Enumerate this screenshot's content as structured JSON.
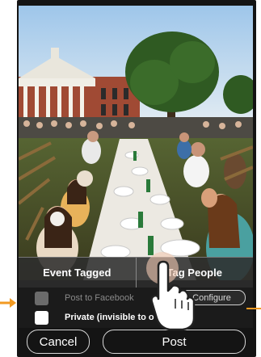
{
  "tabs": [
    {
      "label": "Event Tagged"
    },
    {
      "label": "Tag People"
    }
  ],
  "options": {
    "facebook": {
      "label": "Post to Facebook",
      "checked": false
    },
    "private": {
      "label": "Private (invisible to o",
      "checked": true
    },
    "configure_label": "Configure"
  },
  "buttons": {
    "cancel": "Cancel",
    "post": "Post"
  },
  "colors": {
    "accent_arrow": "#F29A22",
    "panel": "#1B1B1B",
    "phone": "#141414"
  },
  "icons": [
    "hand-pointer-icon",
    "orange-arrow-icon"
  ]
}
